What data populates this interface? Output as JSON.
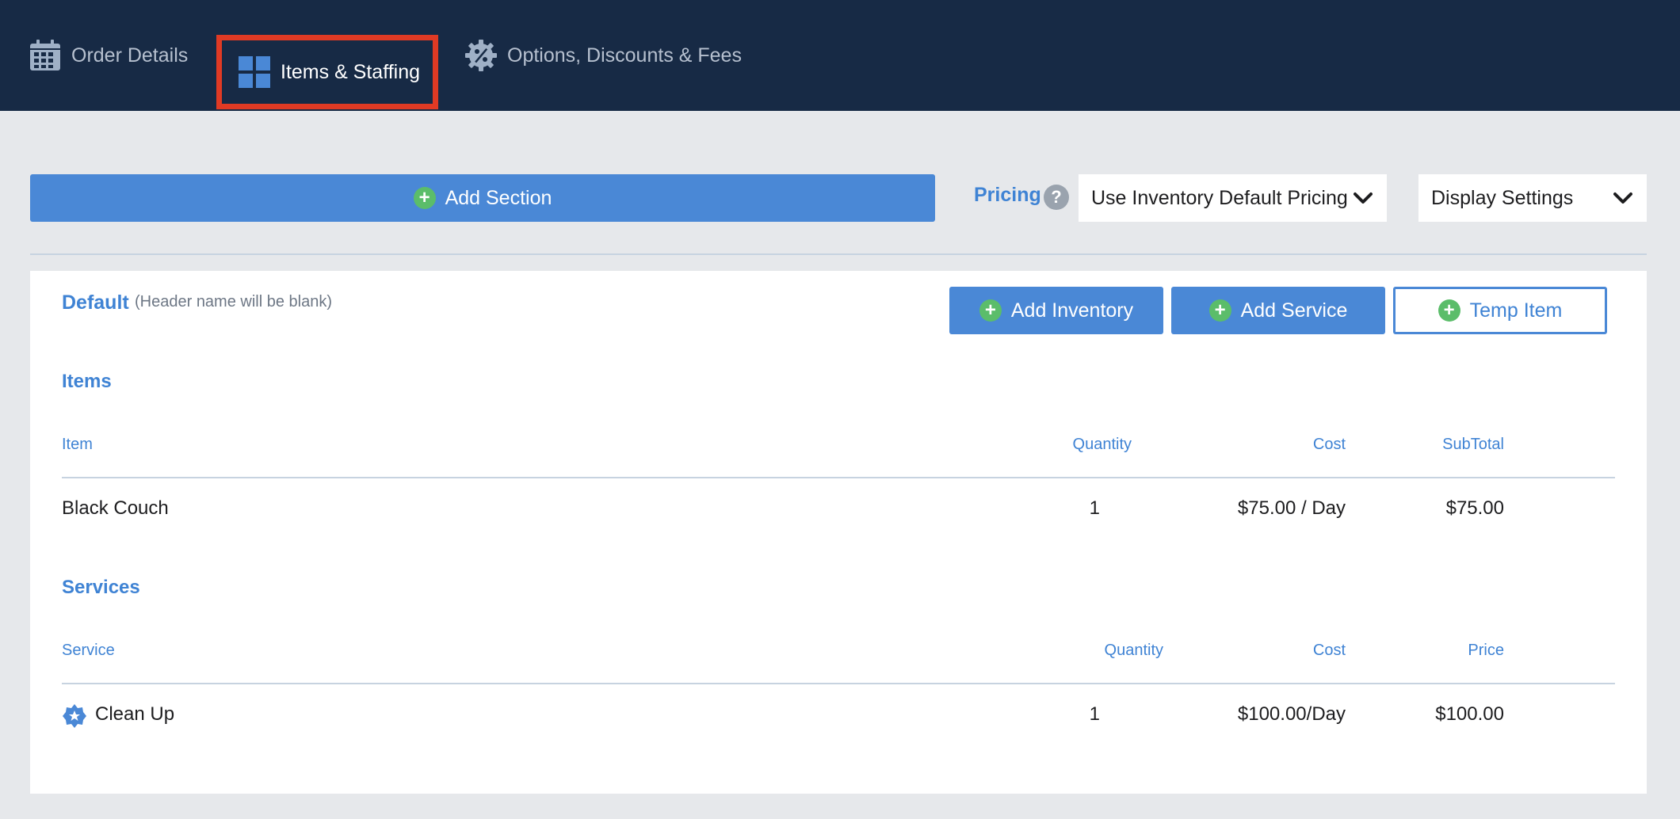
{
  "tabs": [
    {
      "label": "Order Details",
      "icon": "calendar-icon",
      "active": false
    },
    {
      "label": "Items & Staffing",
      "icon": "grid-icon",
      "active": true
    },
    {
      "label": "Options, Discounts & Fees",
      "icon": "percent-gear-icon",
      "active": false
    }
  ],
  "toolbar": {
    "add_section_label": "Add Section",
    "pricing_label": "Pricing",
    "help_glyph": "?",
    "pricing_select_value": "Use Inventory Default Pricing",
    "display_settings_label": "Display Settings"
  },
  "section": {
    "title": "Default",
    "note": "(Header name will be blank)",
    "add_inventory_label": "Add Inventory",
    "add_service_label": "Add Service",
    "temp_item_label": "Temp Item"
  },
  "items": {
    "title": "Items",
    "headers": {
      "item": "Item",
      "quantity": "Quantity",
      "cost": "Cost",
      "subtotal": "SubTotal"
    },
    "rows": [
      {
        "name": "Black Couch",
        "quantity": "1",
        "cost": "$75.00 / Day",
        "subtotal": "$75.00"
      }
    ]
  },
  "services": {
    "title": "Services",
    "headers": {
      "service": "Service",
      "quantity": "Quantity",
      "cost": "Cost",
      "price": "Price"
    },
    "rows": [
      {
        "name": "Clean Up",
        "quantity": "1",
        "cost": "$100.00/Day",
        "price": "$100.00",
        "icon": "service-badge-icon"
      }
    ]
  },
  "colors": {
    "nav_bg": "#172a45",
    "accent": "#4a88d6",
    "active_tab_outline": "#e03a24",
    "plus_green": "#5bbd6a"
  }
}
